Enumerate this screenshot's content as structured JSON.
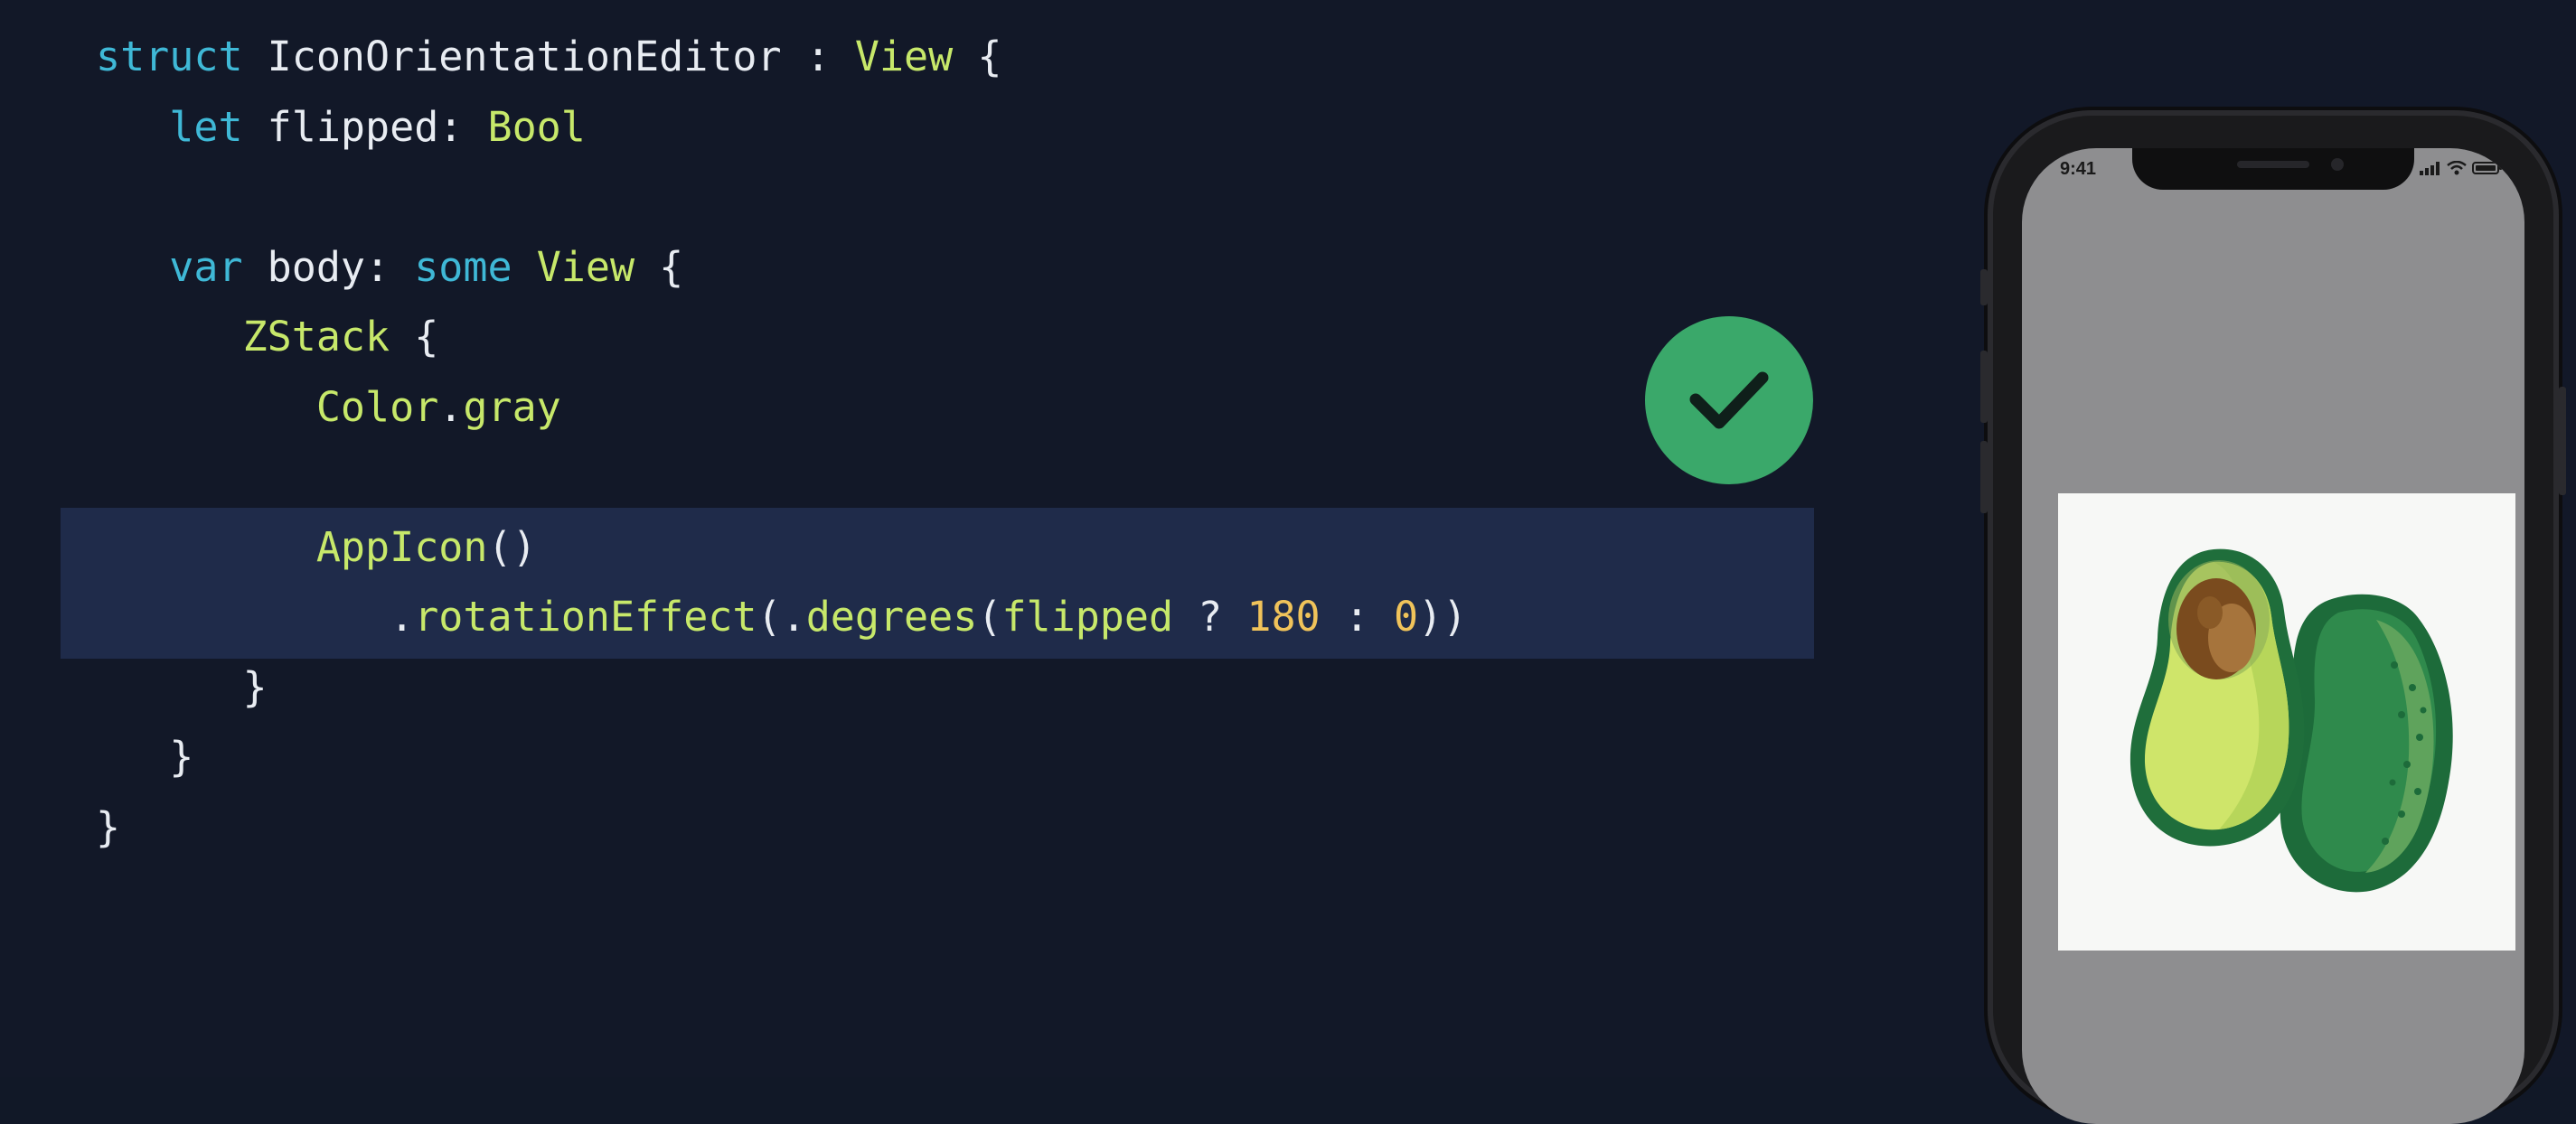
{
  "code": {
    "lines": [
      [
        {
          "t": "struct",
          "c": "keyword"
        },
        {
          "t": " IconOrientationEditor : ",
          "c": "plain"
        },
        {
          "t": "View",
          "c": "type"
        },
        {
          "t": " {",
          "c": "plain"
        }
      ],
      [
        {
          "t": "   let",
          "c": "keyword"
        },
        {
          "t": " flipped: ",
          "c": "plain"
        },
        {
          "t": "Bool",
          "c": "type"
        }
      ],
      [],
      [
        {
          "t": "   var",
          "c": "keyword"
        },
        {
          "t": " body: ",
          "c": "plain"
        },
        {
          "t": "some",
          "c": "keyword"
        },
        {
          "t": " ",
          "c": "plain"
        },
        {
          "t": "View",
          "c": "type"
        },
        {
          "t": " {",
          "c": "plain"
        }
      ],
      [
        {
          "t": "      ZStack",
          "c": "type"
        },
        {
          "t": " {",
          "c": "plain"
        }
      ],
      [
        {
          "t": "         Color",
          "c": "type"
        },
        {
          "t": ".",
          "c": "plain"
        },
        {
          "t": "gray",
          "c": "call"
        }
      ],
      [],
      [
        {
          "t": "         AppIcon",
          "c": "type"
        },
        {
          "t": "()",
          "c": "plain"
        }
      ],
      [
        {
          "t": "            .",
          "c": "plain"
        },
        {
          "t": "rotationEffect",
          "c": "call"
        },
        {
          "t": "(.",
          "c": "plain"
        },
        {
          "t": "degrees",
          "c": "call"
        },
        {
          "t": "(",
          "c": "plain"
        },
        {
          "t": "flipped",
          "c": "call"
        },
        {
          "t": " ? ",
          "c": "plain"
        },
        {
          "t": "180",
          "c": "number"
        },
        {
          "t": " : ",
          "c": "plain"
        },
        {
          "t": "0",
          "c": "number"
        },
        {
          "t": "))",
          "c": "plain"
        }
      ],
      [
        {
          "t": "      }",
          "c": "plain"
        }
      ],
      [
        {
          "t": "   }",
          "c": "plain"
        }
      ],
      [
        {
          "t": "}",
          "c": "plain"
        }
      ]
    ]
  },
  "badge": {
    "icon": "checkmark-icon",
    "color": "#3aa86a"
  },
  "phone": {
    "status_time": "9:41",
    "status_icons": [
      "signal-icon",
      "wifi-icon",
      "battery-icon"
    ],
    "app_icon": "avocado-icon"
  },
  "colors": {
    "background": "#121828",
    "highlight": "#1f2b4a",
    "keyword": "#3fb8d6",
    "type": "#c7e86a",
    "number": "#f0c35a",
    "plain": "#e8ecf2"
  }
}
